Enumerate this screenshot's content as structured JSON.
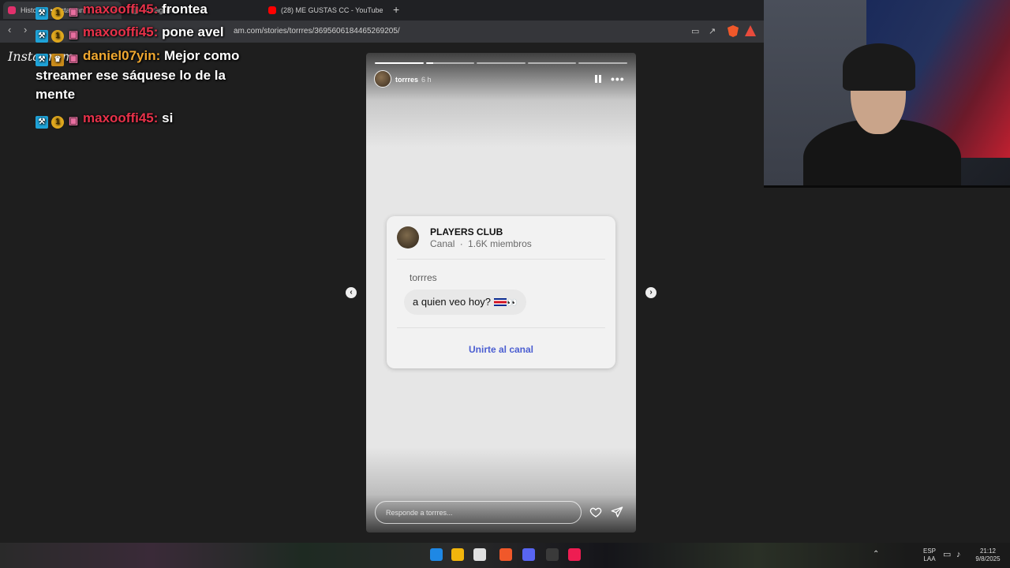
{
  "browser": {
    "tabs": [
      {
        "title": "Historias • Instagram",
        "favicon_color": "#e1306c"
      },
      {
        "title": "Instagram",
        "favicon_color": "#888888"
      },
      {
        "title": "(28) ME GUSTAS CC - YouTube",
        "favicon_color": "#ff0000"
      }
    ],
    "new_tab": "+",
    "url": "am.com/stories/torrres/3695606184465269205/",
    "tab_close": "×"
  },
  "instagram_logo": "Instagram",
  "chat": [
    {
      "user": "maxooffi45:",
      "message": "frontea"
    },
    {
      "user": "maxooffi45:",
      "message": "pone avel"
    },
    {
      "user": "daniel07yin:",
      "message": "Mejor como streamer ese sáquese lo de la mente"
    },
    {
      "user": "maxooffi45:",
      "message": "si"
    }
  ],
  "story": {
    "username": "torrres",
    "time": "6 h",
    "segments": 5,
    "current_segment_progress": 0.15,
    "card": {
      "channel_name": "PLAYERS CLUB",
      "channel_type": "Canal",
      "separator": "·",
      "members": "1.6K miembros",
      "author": "torrres",
      "message": "a quien veo hoy?",
      "emoji": "👀",
      "join_button": "Unirte al canal"
    },
    "reply_placeholder": "Responde a torrres...",
    "colors": {
      "join": "#4b5ed1"
    }
  },
  "nav": {
    "prev": "‹",
    "next": "›"
  },
  "tray": {
    "lang_1": "ESP",
    "lang_2": "LAA",
    "time": "21:12",
    "date": "9/8/2025"
  }
}
